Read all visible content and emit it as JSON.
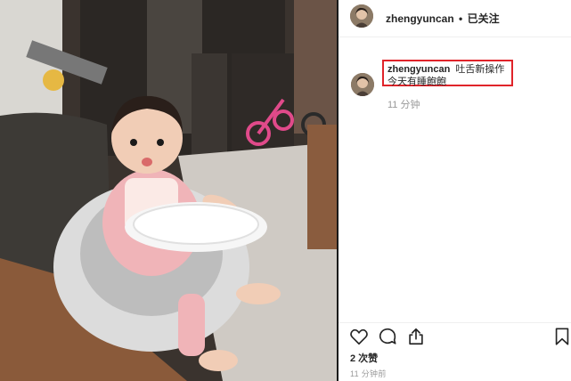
{
  "post": {
    "username": "zhengyuncan",
    "separator": "•",
    "follow_status": "已关注"
  },
  "comment": {
    "username": "zhengyuncan",
    "text_line1": "吐舌新操作",
    "text_line2": "今天有睡飽飽",
    "time": "11 分钟"
  },
  "actions": {
    "like_icon": "heart-icon",
    "comment_icon": "speech-bubble-icon",
    "share_icon": "share-icon",
    "save_icon": "bookmark-icon"
  },
  "likes_text": "2 次赞",
  "post_time": "11 分钟前",
  "colors": {
    "highlight_box": "#e0242a",
    "meta_gray": "#999999"
  }
}
